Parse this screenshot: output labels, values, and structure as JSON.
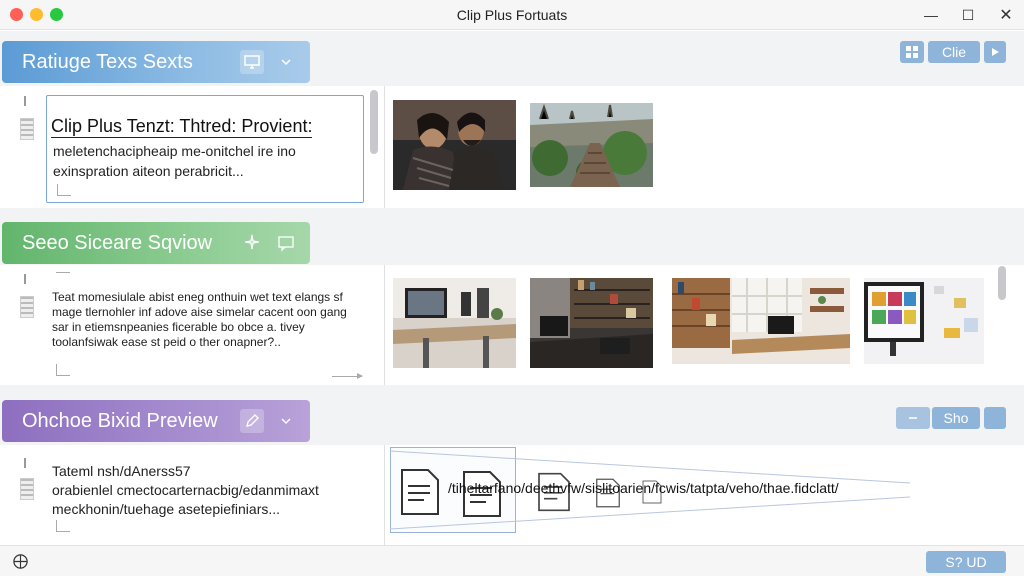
{
  "window": {
    "title": "Clip Plus Fortuats",
    "minimize_glyph": "—",
    "maximize_glyph": "☐",
    "close_glyph": "✕"
  },
  "toolbar": {
    "grid_icon": "grid-icon",
    "clip_label": "Clie",
    "play_icon": "play-icon"
  },
  "sections": [
    {
      "title": "Ratiuge Texs Sexts",
      "color": "#5b9bd5",
      "icons": [
        "monitor-icon",
        "chevron-down-icon"
      ],
      "text": {
        "title": "Clip Plus Tenzt: Thtred: Provient:",
        "lines": [
          "meletenchacipheaip me-onitchel ire ino",
          "exinspration aiteon perabricit..."
        ]
      },
      "thumbnails": [
        "couple-photo",
        "garden-path-photo"
      ]
    },
    {
      "title": "Seeo Siceare Sqviow",
      "color": "#62b56c",
      "icons": [
        "sparkle-icon",
        "comment-icon"
      ],
      "text": {
        "lines": [
          "Teat momesiulale abist eneg onthuin wet text elangs sf",
          "mage tlernohler inf adove aise simelar cacent oon gang",
          "sar in etiemsnpeanies ficerable bo obce a. tivey",
          "toolanfsiwak ease st peid o ther onapner?.."
        ]
      },
      "thumbnails": [
        "desk-monitor-photo",
        "office-shelves-photo",
        "bright-office-photo",
        "screen-charts-photo"
      ]
    },
    {
      "title": "Ohchoe Bixid Preview",
      "color": "#8e6fc0",
      "icons": [
        "pen-icon",
        "chevron-down-icon"
      ],
      "toolbar_label": "Sho",
      "text": {
        "lines": [
          "Tateml nsh/dAnerss57",
          "orabienlel cmectocarternacbig/edanmimaxt",
          "meckhonin/tuehage asetepiefiniars..."
        ]
      },
      "path": "/tiheltarfano/deethvfw/sislitoarien/fcwis/tatpta/veho/thae.fidclatt/"
    }
  ],
  "status": {
    "icon": "globe-icon",
    "button_label": "S? UD"
  }
}
